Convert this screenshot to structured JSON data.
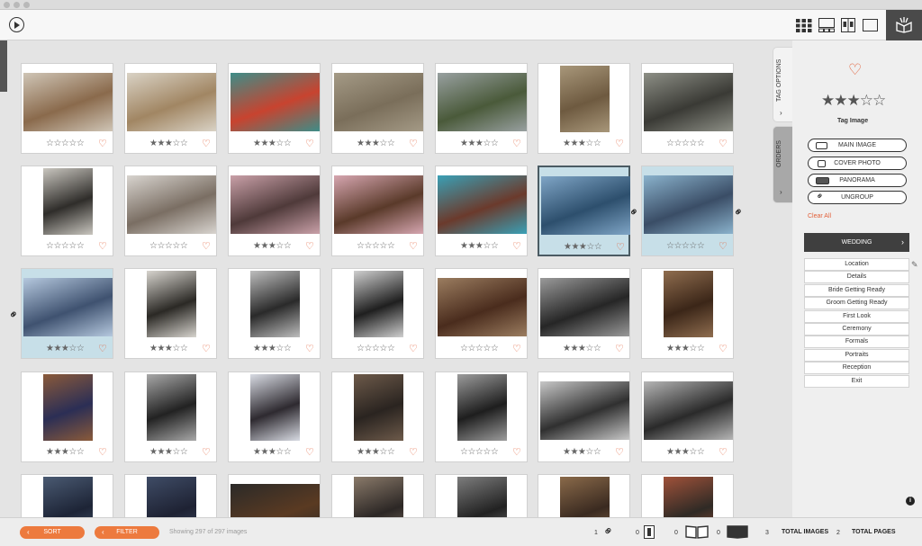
{
  "toolbar": {
    "play_icon": "play-circle-icon",
    "view_buttons": [
      "grid-view-icon",
      "single-view-icon",
      "compare-view-icon",
      "full-view-icon"
    ],
    "logo_icon": "book-logo-icon"
  },
  "grid": {
    "cards": [
      {
        "rating": 0,
        "favorite": false,
        "tone": "color",
        "photo_colors": [
          "#8a6a4c",
          "#cfc5b6"
        ]
      },
      {
        "rating": 3,
        "favorite": false,
        "tone": "color",
        "photo_colors": [
          "#a18663",
          "#d9d2c5"
        ]
      },
      {
        "rating": 3,
        "favorite": false,
        "tone": "color",
        "photo_colors": [
          "#c8432f",
          "#3e8d88"
        ]
      },
      {
        "rating": 3,
        "favorite": false,
        "tone": "color",
        "photo_colors": [
          "#7a6e5a",
          "#a49a86"
        ]
      },
      {
        "rating": 3,
        "favorite": false,
        "tone": "color",
        "photo_colors": [
          "#4a5a3a",
          "#98a0a0"
        ]
      },
      {
        "rating": 3,
        "favorite": false,
        "tone": "color",
        "photo_colors": [
          "#6e5a40",
          "#a8977a"
        ]
      },
      {
        "rating": 0,
        "favorite": false,
        "tone": "color",
        "photo_colors": [
          "#3a3a35",
          "#8d8f86"
        ]
      },
      {
        "rating": 0,
        "favorite": false,
        "tone": "color",
        "photo_colors": [
          "#2f2d2a",
          "#c9c6bf"
        ]
      },
      {
        "rating": 0,
        "favorite": false,
        "tone": "color",
        "photo_colors": [
          "#7a6e63",
          "#d8d4cf"
        ]
      },
      {
        "rating": 3,
        "favorite": false,
        "tone": "color",
        "photo_colors": [
          "#4f3a3a",
          "#c9a0a8"
        ]
      },
      {
        "rating": 0,
        "favorite": false,
        "tone": "color",
        "photo_colors": [
          "#5a3a2a",
          "#d6a6b0"
        ]
      },
      {
        "rating": 3,
        "favorite": false,
        "tone": "color",
        "photo_colors": [
          "#6b3a2c",
          "#3aa0b6"
        ]
      },
      {
        "rating": 3,
        "favorite": false,
        "tone": "color",
        "photo_colors": [
          "#2d4f6d",
          "#7fa5c6"
        ],
        "selected": "active"
      },
      {
        "rating": 0,
        "favorite": false,
        "tone": "color",
        "photo_colors": [
          "#3a4d66",
          "#8ab2cc"
        ],
        "selected": "group"
      },
      {
        "rating": 3,
        "favorite": false,
        "tone": "color",
        "photo_colors": [
          "#3f5270",
          "#b5c8de"
        ],
        "selected": "group"
      },
      {
        "rating": 3,
        "favorite": false,
        "tone": "color",
        "photo_colors": [
          "#2b2925",
          "#d7d4ce"
        ]
      },
      {
        "rating": 3,
        "favorite": false,
        "tone": "bw",
        "photo_colors": [
          "#2a2a2a",
          "#bdbdbd"
        ]
      },
      {
        "rating": 0,
        "favorite": false,
        "tone": "bw",
        "photo_colors": [
          "#1f1f1f",
          "#cfcfcf"
        ]
      },
      {
        "rating": 0,
        "favorite": false,
        "tone": "color",
        "photo_colors": [
          "#4a2c1d",
          "#9b7d60"
        ]
      },
      {
        "rating": 3,
        "favorite": false,
        "tone": "bw",
        "photo_colors": [
          "#262626",
          "#9a9a9a"
        ]
      },
      {
        "rating": 3,
        "favorite": false,
        "tone": "color",
        "photo_colors": [
          "#3b2618",
          "#8f6d4f"
        ]
      },
      {
        "rating": 3,
        "favorite": false,
        "tone": "color",
        "photo_colors": [
          "#2b2e55",
          "#8a5a3a"
        ]
      },
      {
        "rating": 3,
        "favorite": false,
        "tone": "bw",
        "photo_colors": [
          "#222222",
          "#a8a8a8"
        ]
      },
      {
        "rating": 3,
        "favorite": false,
        "tone": "color",
        "photo_colors": [
          "#2e2a30",
          "#d8dbe3"
        ]
      },
      {
        "rating": 3,
        "favorite": false,
        "tone": "color",
        "photo_colors": [
          "#2a2420",
          "#6d5a4a"
        ]
      },
      {
        "rating": 0,
        "favorite": false,
        "tone": "bw",
        "photo_colors": [
          "#1e1e1e",
          "#9c9c9c"
        ]
      },
      {
        "rating": 3,
        "favorite": false,
        "tone": "bw",
        "photo_colors": [
          "#303030",
          "#c7c7c7"
        ]
      },
      {
        "rating": 3,
        "favorite": false,
        "tone": "bw",
        "photo_colors": [
          "#2a2a2a",
          "#b5b5b5"
        ]
      },
      {
        "rating": 0,
        "favorite": false,
        "tone": "color",
        "photo_colors": [
          "#1d2436",
          "#4a5a72"
        ]
      },
      {
        "rating": 0,
        "favorite": false,
        "tone": "color",
        "photo_colors": [
          "#1e2233",
          "#3f4c66"
        ]
      },
      {
        "rating": 0,
        "favorite": false,
        "tone": "color",
        "photo_colors": [
          "#5a3a22",
          "#2b2a28"
        ]
      },
      {
        "rating": 0,
        "favorite": false,
        "tone": "color",
        "photo_colors": [
          "#2c2725",
          "#8a7a6a"
        ]
      },
      {
        "rating": 0,
        "favorite": false,
        "tone": "bw",
        "photo_colors": [
          "#222222",
          "#7d7d7d"
        ]
      },
      {
        "rating": 0,
        "favorite": false,
        "tone": "color",
        "photo_colors": [
          "#3a2a20",
          "#8a6a4a"
        ]
      },
      {
        "rating": 0,
        "favorite": false,
        "tone": "color",
        "photo_colors": [
          "#2f2a25",
          "#a0523a"
        ]
      }
    ],
    "links": [
      {
        "icon": "link-icon"
      },
      {
        "icon": "link-icon"
      },
      {
        "icon": "link-icon"
      }
    ]
  },
  "sidebar": {
    "tabs": [
      {
        "label": "TAG OPTIONS",
        "icon": "chevron-right-icon"
      },
      {
        "label": "ORDERS",
        "icon": "chevron-right-icon"
      }
    ],
    "favorite_icon": "heart-icon",
    "tag_rating": 3,
    "tag_label": "Tag Image",
    "buttons": [
      {
        "label": "MAIN IMAGE",
        "icon": "main-image-icon"
      },
      {
        "label": "COVER PHOTO",
        "icon": "cover-photo-icon"
      },
      {
        "label": "PANORAMA",
        "icon": "panorama-icon"
      },
      {
        "label": "UNGROUP",
        "icon": "link-icon"
      }
    ],
    "clear_all": "Clear All",
    "category": "WEDDING",
    "subcategories": [
      "Location",
      "Details",
      "Bride Getting Ready",
      "Groom Getting Ready",
      "First Look",
      "Ceremony",
      "Formals",
      "Portraits",
      "Reception",
      "Exit"
    ],
    "edit_icon": "pencil-icon",
    "info_icon": "info-icon"
  },
  "bottombar": {
    "sort_label": "SORT",
    "filter_label": "FILTER",
    "showing": "Showing 297 of 297 images",
    "counts": [
      {
        "value": "1",
        "icon": "link-icon"
      },
      {
        "value": "0",
        "icon": "single-page-icon"
      },
      {
        "value": "0",
        "icon": "open-book-icon"
      },
      {
        "value": "0",
        "icon": "panorama-book-icon"
      }
    ],
    "total_images_value": "3",
    "total_images_label": "TOTAL IMAGES",
    "total_pages_value": "2",
    "total_pages_label": "TOTAL PAGES"
  },
  "colors": {
    "accent": "#e2603a",
    "button_orange": "#ed7a3e",
    "selection_blue": "#c7dfe8",
    "dark_button": "#3f3f3f"
  }
}
